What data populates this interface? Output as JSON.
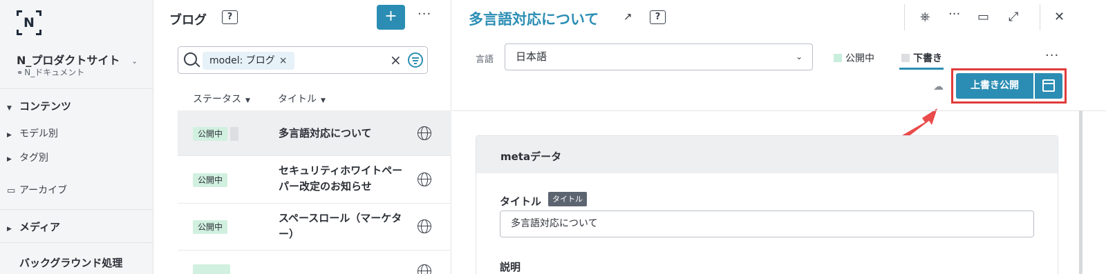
{
  "sidebar": {
    "logo_letter": "N",
    "site_name": "N_プロダクトサイト",
    "site_sub": "N_ドキュメント",
    "items": [
      {
        "label": "コンテンツ"
      },
      {
        "label": "モデル別"
      },
      {
        "label": "タグ別"
      },
      {
        "label": "アーカイブ"
      },
      {
        "label": "メディア"
      },
      {
        "label": "バックグラウンド処理"
      }
    ]
  },
  "list": {
    "title": "ブログ",
    "help": "?",
    "add": "+",
    "more": "···",
    "search_chip": "model: ブログ",
    "chip_close": "×",
    "clear": "×",
    "columns": [
      "ステータス",
      "タイトル"
    ],
    "rows": [
      {
        "status": "公開中",
        "title": "多言語対応について"
      },
      {
        "status": "公開中",
        "title": "セキュリティホワイトペーパー改定のお知らせ"
      },
      {
        "status": "公開中",
        "title": "スペースロール（マーケター）"
      }
    ]
  },
  "editor": {
    "title": "多言語対応について",
    "ext_icon": "↗",
    "help": "?",
    "more": "···",
    "lang_label": "言語",
    "lang_value": "日本語",
    "tabs": [
      {
        "label": "公開中",
        "color": "#c9eedb"
      },
      {
        "label": "下書き",
        "color": "#dcdee1"
      }
    ],
    "publish_button": "上書き公開",
    "section_title": "metaデータ",
    "field_title_label": "タイトル",
    "field_title_tag": "タイトル",
    "field_title_value": "多言語対応について",
    "field_desc_label": "説明"
  },
  "colors": {
    "accent": "#2b8db3",
    "highlight": "#e03b3b"
  }
}
